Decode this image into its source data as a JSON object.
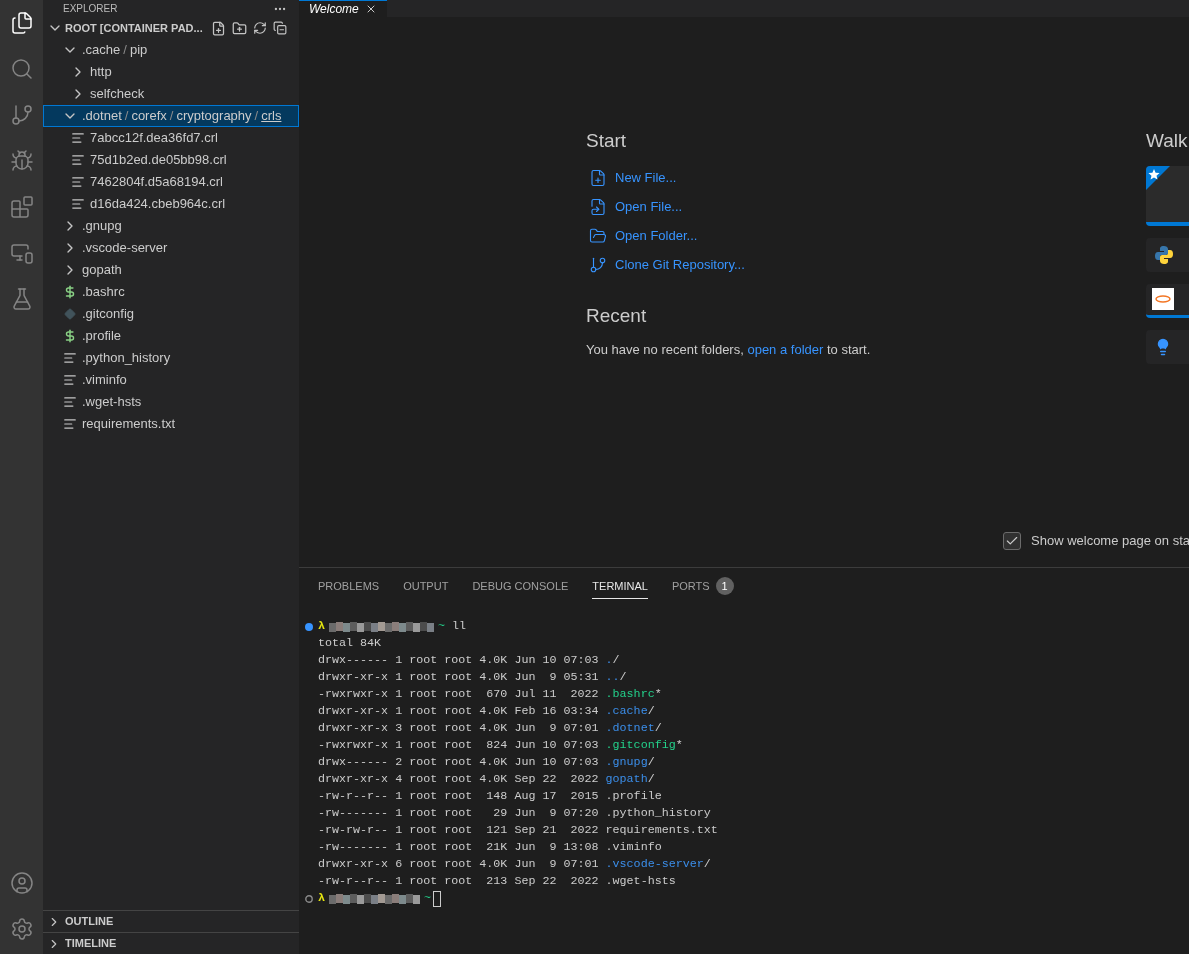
{
  "activity_bar": [
    {
      "kind": "explorer",
      "selected": true
    },
    {
      "kind": "search",
      "selected": false
    },
    {
      "kind": "source_control",
      "selected": false
    },
    {
      "kind": "run_debug",
      "selected": false
    },
    {
      "kind": "extensions",
      "selected": false
    },
    {
      "kind": "remote",
      "selected": false
    },
    {
      "kind": "testing",
      "selected": false
    }
  ],
  "activity_bar_bottom": [
    {
      "kind": "account"
    },
    {
      "kind": "settings"
    }
  ],
  "sidebar": {
    "title": "EXPLORER",
    "separator": "/",
    "root": "ROOT [CONTAINER PAD...",
    "tree": [
      {
        "kind": "folder",
        "segments": [
          ".cache",
          "pip"
        ],
        "expanded": true,
        "selected": false,
        "children": [
          {
            "kind": "folder",
            "segments": [
              "http"
            ],
            "expanded": false,
            "selected": false
          },
          {
            "kind": "folder",
            "segments": [
              "selfcheck"
            ],
            "expanded": false,
            "selected": false
          }
        ]
      },
      {
        "kind": "folder",
        "segments": [
          ".dotnet",
          "corefx",
          "cryptography",
          "crls"
        ],
        "expanded": true,
        "selected": true,
        "children": [
          {
            "kind": "text",
            "segments": [
              "7abcc12f.dea36fd7.crl"
            ],
            "selected": false
          },
          {
            "kind": "text",
            "segments": [
              "75d1b2ed.de05bb98.crl"
            ],
            "selected": false
          },
          {
            "kind": "text",
            "segments": [
              "7462804f.d5a68194.crl"
            ],
            "selected": false
          },
          {
            "kind": "text",
            "segments": [
              "d16da424.cbeb964c.crl"
            ],
            "selected": false
          }
        ]
      },
      {
        "kind": "folder",
        "segments": [
          ".gnupg"
        ],
        "expanded": false,
        "selected": false
      },
      {
        "kind": "folder",
        "segments": [
          ".vscode-server"
        ],
        "expanded": false,
        "selected": false
      },
      {
        "kind": "folder",
        "segments": [
          "gopath"
        ],
        "expanded": false,
        "selected": false
      },
      {
        "kind": "shell",
        "segments": [
          ".bashrc"
        ],
        "selected": false
      },
      {
        "kind": "git",
        "segments": [
          ".gitconfig"
        ],
        "selected": false
      },
      {
        "kind": "shell",
        "segments": [
          ".profile"
        ],
        "selected": false
      },
      {
        "kind": "text",
        "segments": [
          ".python_history"
        ],
        "selected": false
      },
      {
        "kind": "text",
        "segments": [
          ".viminfo"
        ],
        "selected": false
      },
      {
        "kind": "text",
        "segments": [
          ".wget-hsts"
        ],
        "selected": false
      },
      {
        "kind": "text",
        "segments": [
          "requirements.txt"
        ],
        "selected": false
      }
    ],
    "sections": [
      {
        "label": "OUTLINE",
        "expanded": false
      },
      {
        "label": "TIMELINE",
        "expanded": false
      }
    ]
  },
  "editor": {
    "tab": "Welcome",
    "start": {
      "title": "Start",
      "actions": [
        {
          "kind": "new_file",
          "label": "New File..."
        },
        {
          "kind": "open_file",
          "label": "Open File..."
        },
        {
          "kind": "open_folder",
          "label": "Open Folder..."
        },
        {
          "kind": "clone",
          "label": "Clone Git Repository..."
        }
      ]
    },
    "recent": {
      "title": "Recent",
      "before": "You have no recent folders,",
      "link": "open a folder",
      "after": "to start."
    },
    "walkthroughs": {
      "title": "Walk",
      "cards": [
        {
          "kind": "featured"
        },
        {
          "kind": "python"
        },
        {
          "kind": "jupyter"
        },
        {
          "kind": "tips"
        }
      ]
    },
    "show_on_startup": {
      "label": "Show welcome page on sta",
      "checked": true
    }
  },
  "panel": {
    "tabs": [
      {
        "label": "PROBLEMS",
        "selected": false
      },
      {
        "label": "OUTPUT",
        "selected": false
      },
      {
        "label": "DEBUG CONSOLE",
        "selected": false
      },
      {
        "label": "TERMINAL",
        "selected": true
      },
      {
        "label": "PORTS",
        "selected": false,
        "badge": "1"
      }
    ],
    "terminal": {
      "prompt": "λ",
      "tilde": "~",
      "command": "ll",
      "end_prompt": "λ",
      "end_tilde": "~",
      "total": "total 84K",
      "lines": [
        {
          "info": "drwx------ 1 root root 4.0K Jun 10 07:03 ",
          "name": ".",
          "suffix": "/",
          "kind": "dir"
        },
        {
          "info": "drwxr-xr-x 1 root root 4.0K Jun  9 05:31 ",
          "name": "..",
          "suffix": "/",
          "kind": "dir"
        },
        {
          "info": "-rwxrwxr-x 1 root root  670 Jul 11  2022 ",
          "name": ".bashrc",
          "suffix": "*",
          "kind": "exec"
        },
        {
          "info": "drwxr-xr-x 1 root root 4.0K Feb 16 03:34 ",
          "name": ".cache",
          "suffix": "/",
          "kind": "dir"
        },
        {
          "info": "drwxr-xr-x 3 root root 4.0K Jun  9 07:01 ",
          "name": ".dotnet",
          "suffix": "/",
          "kind": "dir"
        },
        {
          "info": "-rwxrwxr-x 1 root root  824 Jun 10 07:03 ",
          "name": ".gitconfig",
          "suffix": "*",
          "kind": "exec"
        },
        {
          "info": "drwx------ 2 root root 4.0K Jun 10 07:03 ",
          "name": ".gnupg",
          "suffix": "/",
          "kind": "dir"
        },
        {
          "info": "drwxr-xr-x 4 root root 4.0K Sep 22  2022 ",
          "name": "gopath",
          "suffix": "/",
          "kind": "dir"
        },
        {
          "info": "-rw-r--r-- 1 root root  148 Aug 17  2015 ",
          "name": ".profile",
          "kind": "file"
        },
        {
          "info": "-rw------- 1 root root   29 Jun  9 07:20 ",
          "name": ".python_history",
          "kind": "file"
        },
        {
          "info": "-rw-rw-r-- 1 root root  121 Sep 21  2022 ",
          "name": "requirements.txt",
          "kind": "file"
        },
        {
          "info": "-rw------- 1 root root  21K Jun  9 13:08 ",
          "name": ".viminfo",
          "kind": "file"
        },
        {
          "info": "drwxr-xr-x 6 root root 4.0K Jun  9 07:01 ",
          "name": ".vscode-server",
          "suffix": "/",
          "kind": "dir"
        },
        {
          "info": "-rw-r--r-- 1 root root  213 Sep 22  2022 ",
          "name": ".wget-hsts",
          "kind": "file"
        }
      ]
    }
  }
}
